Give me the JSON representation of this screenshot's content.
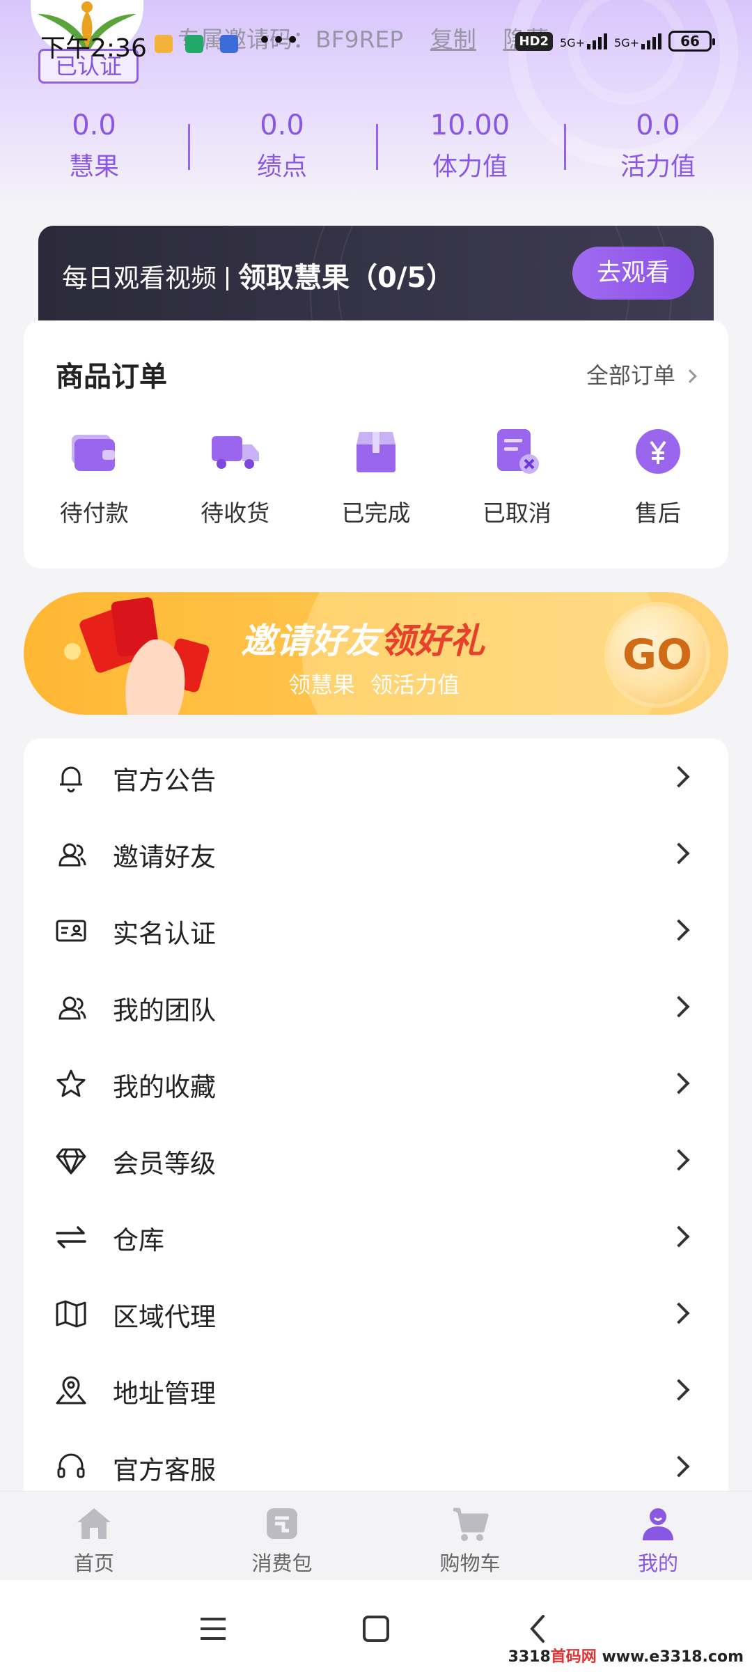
{
  "status_bar": {
    "time": "下午2:36",
    "battery": "66",
    "network_1": "5G+",
    "network_2": "5G+",
    "hd": "HD2"
  },
  "profile": {
    "verified_badge": "已认证",
    "invite_code_label": "专属邀请码：BF9REP",
    "copy_label": "复制",
    "hide_label": "隐藏"
  },
  "stats": [
    {
      "value": "0.0",
      "label": "慧果"
    },
    {
      "value": "0.0",
      "label": "绩点"
    },
    {
      "value": "10.00",
      "label": "体力值"
    },
    {
      "value": "0.0",
      "label": "活力值"
    }
  ],
  "video_banner": {
    "text_left": "每日观看视频",
    "text_right": "领取慧果（0/5）",
    "button": "去观看"
  },
  "orders": {
    "title": "商品订单",
    "all_orders": "全部订单",
    "items": [
      {
        "label": "待付款",
        "icon": "wallet-icon"
      },
      {
        "label": "待收货",
        "icon": "truck-icon"
      },
      {
        "label": "已完成",
        "icon": "box-icon"
      },
      {
        "label": "已取消",
        "icon": "cancel-doc-icon"
      },
      {
        "label": "售后",
        "icon": "yen-icon"
      }
    ]
  },
  "invite_banner": {
    "title_a": "邀请好友",
    "title_b": "领好礼",
    "sub_1": "领慧果",
    "sub_2": "领活力值",
    "go": "GO"
  },
  "menu": [
    {
      "label": "官方公告",
      "icon": "bell-icon"
    },
    {
      "label": "邀请好友",
      "icon": "users-icon"
    },
    {
      "label": "实名认证",
      "icon": "id-card-icon"
    },
    {
      "label": "我的团队",
      "icon": "team-icon"
    },
    {
      "label": "我的收藏",
      "icon": "star-icon"
    },
    {
      "label": "会员等级",
      "icon": "diamond-icon"
    },
    {
      "label": "仓库",
      "icon": "transfer-icon"
    },
    {
      "label": "区域代理",
      "icon": "map-icon"
    },
    {
      "label": "地址管理",
      "icon": "location-icon"
    },
    {
      "label": "官方客服",
      "icon": "headset-icon"
    }
  ],
  "tabs": [
    {
      "label": "首页",
      "icon": "home-icon"
    },
    {
      "label": "消费包",
      "icon": "wallet-tab-icon"
    },
    {
      "label": "购物车",
      "icon": "cart-icon"
    },
    {
      "label": "我的",
      "icon": "user-icon"
    }
  ],
  "watermark": {
    "a": "3318",
    "b": "首码网",
    "c": "www.e3318.com"
  },
  "colors": {
    "accent": "#8a56e4",
    "banner_orange": "#ffb733",
    "dark_banner": "#2b2a3a"
  }
}
